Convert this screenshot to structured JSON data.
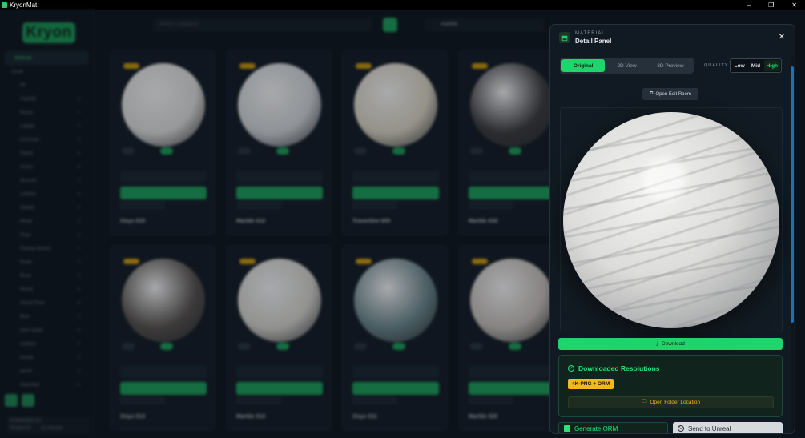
{
  "window": {
    "title": "KryonMat",
    "minimize": "–",
    "maximize": "❐",
    "close": "✕"
  },
  "sidebar": {
    "logo": "Kryon",
    "items": [
      {
        "label": "Material",
        "count": ""
      },
      {
        "label": "Local",
        "count": ""
      },
      {
        "label": "All",
        "count": ""
      },
      {
        "label": "Asphalt",
        "count": "4"
      },
      {
        "label": "Bricks",
        "count": "4"
      },
      {
        "label": "Carpet",
        "count": "4"
      },
      {
        "label": "Concrete",
        "count": "4"
      },
      {
        "label": "Fabric",
        "count": "4"
      },
      {
        "label": "Grass",
        "count": "4"
      },
      {
        "label": "Ground",
        "count": "4"
      },
      {
        "label": "Leather",
        "count": "4"
      },
      {
        "label": "Marble",
        "count": "4"
      },
      {
        "label": "Metal",
        "count": "4"
      },
      {
        "label": "Onyx",
        "count": "4"
      },
      {
        "label": "Paving Stones",
        "count": "4"
      },
      {
        "label": "Road",
        "count": "4"
      },
      {
        "label": "Rock",
        "count": "4"
      },
      {
        "label": "Wood",
        "count": "4"
      },
      {
        "label": "Wood Floor",
        "count": "4"
      },
      {
        "label": "floor",
        "count": "4"
      },
      {
        "label": "man-made",
        "count": "4"
      },
      {
        "label": "outdoor",
        "count": "4"
      },
      {
        "label": "terrain",
        "count": "4"
      },
      {
        "label": "wood",
        "count": "4"
      },
      {
        "label": "Imported",
        "count": "4"
      }
    ],
    "footer": {
      "label": "POWERED BY",
      "brand": "TextboxUI",
      "version": "v1.Version"
    }
  },
  "toolbar": {
    "category_placeholder": "Select Category",
    "search_value": "marble"
  },
  "cards": [
    {
      "name": "Onyx 015",
      "sphere": "#e6e6e4"
    },
    {
      "name": "Marble 012",
      "sphere": "#d9dde1"
    },
    {
      "name": "Travertine 009",
      "sphere": "#e2dccb"
    },
    {
      "name": "Marble 016",
      "sphere": "#3e3f42"
    },
    {
      "name": "Onyx 013",
      "sphere": "#5a5652"
    },
    {
      "name": "Marble 014",
      "sphere": "#dddcd6"
    },
    {
      "name": "Onyx 011",
      "sphere": "#6f8c93"
    },
    {
      "name": "Marble 020",
      "sphere": "#cdc7c1"
    }
  ],
  "panel": {
    "kicker": "MATERIAL",
    "title": "Detail Panel",
    "close": "✕",
    "tabs": [
      {
        "label": "Original",
        "active": true
      },
      {
        "label": "2D View",
        "active": false
      },
      {
        "label": "3D Preview",
        "active": false
      }
    ],
    "quality_label": "QUALITY",
    "quality_options": [
      {
        "label": "Low",
        "active": false
      },
      {
        "label": "Mid",
        "active": false
      },
      {
        "label": "High",
        "active": true
      }
    ],
    "edit_room": "Open Edit Room",
    "download": "Download",
    "resolutions_title": "Downloaded Resolutions",
    "resolution_badge": "4K-PNG + ORM",
    "open_folder": "Open Folder Location",
    "generate_orm": "Generate ORM",
    "send_unreal": "Send to Unreal"
  },
  "colors": {
    "accent": "#1fd46a",
    "badge": "#f0b91c",
    "panel_bg": "#111a22"
  }
}
